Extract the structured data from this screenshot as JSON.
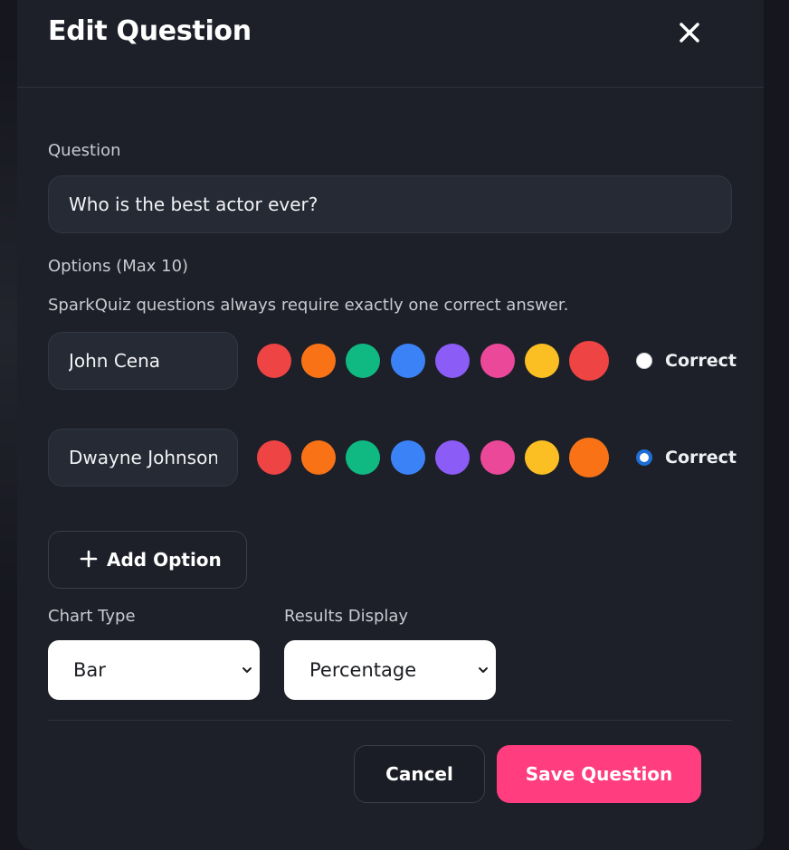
{
  "modal": {
    "title": "Edit Question"
  },
  "question": {
    "label": "Question",
    "value": "Who is the best actor ever?"
  },
  "options": {
    "label": "Options (Max 10)",
    "hint": "SparkQuiz questions always require exactly one correct answer.",
    "palette": [
      "#ef4444",
      "#f97316",
      "#10b981",
      "#3b82f6",
      "#8b5cf6",
      "#ec4899",
      "#fbbf24"
    ],
    "items": [
      {
        "value": "John Cena",
        "selected_color": "#ef4444",
        "correct_label": "Correct",
        "is_correct": false
      },
      {
        "value": "Dwayne Johnson",
        "selected_color": "#f97316",
        "correct_label": "Correct",
        "is_correct": true
      }
    ],
    "add_label": "Add Option"
  },
  "chart_type": {
    "label": "Chart Type",
    "selected": "Bar"
  },
  "results_display": {
    "label": "Results Display",
    "selected": "Percentage"
  },
  "footer": {
    "cancel_label": "Cancel",
    "save_label": "Save Question"
  }
}
